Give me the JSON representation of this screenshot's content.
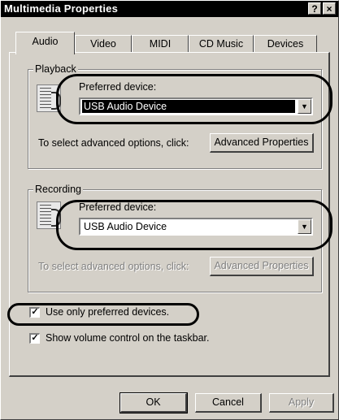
{
  "window": {
    "title": "Multimedia Properties",
    "help_glyph": "?",
    "close_glyph": "×"
  },
  "tabs": [
    {
      "label": "Audio"
    },
    {
      "label": "Video"
    },
    {
      "label": "MIDI"
    },
    {
      "label": "CD Music"
    },
    {
      "label": "Devices"
    }
  ],
  "playback": {
    "group_label": "Playback",
    "preferred_label": "Preferred device:",
    "device_value": "USB Audio Device",
    "advanced_hint": "To select advanced options, click:",
    "advanced_button": "Advanced Properties"
  },
  "recording": {
    "group_label": "Recording",
    "preferred_label": "Preferred device:",
    "device_value": "USB Audio Device",
    "advanced_hint": "To select advanced options, click:",
    "advanced_button": "Advanced Properties"
  },
  "options": {
    "use_only_preferred": {
      "label": "Use only preferred devices.",
      "checked": true
    },
    "show_volume": {
      "label": "Show volume control on the taskbar.",
      "checked": true
    }
  },
  "footer": {
    "ok": "OK",
    "cancel": "Cancel",
    "apply": "Apply"
  },
  "icons": {
    "dropdown": "▼",
    "check": "✓"
  }
}
